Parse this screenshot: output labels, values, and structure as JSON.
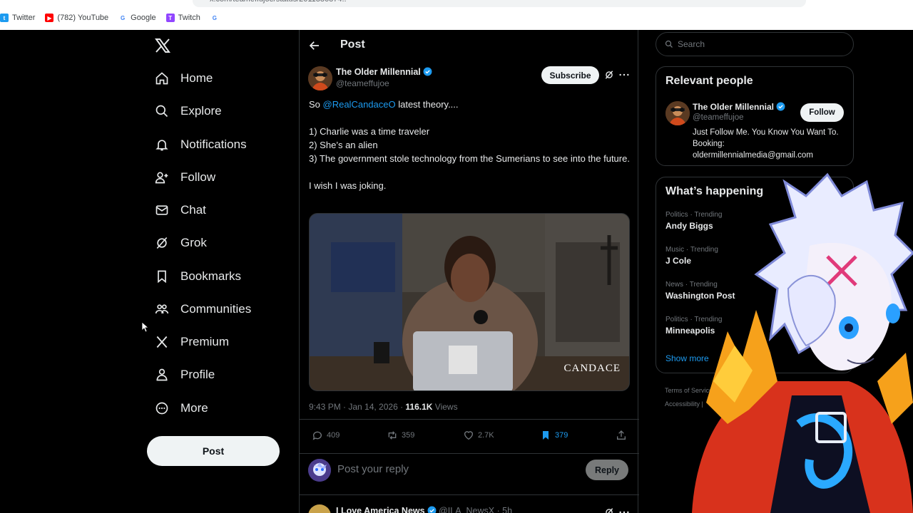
{
  "browser": {
    "url": "x.com/teameffujoe/status/2011886874..",
    "bookmarks": [
      {
        "label": "Twitter",
        "icon": "twitter-icon",
        "color": "#1d9bf0"
      },
      {
        "label": "(782) YouTube",
        "icon": "youtube-icon",
        "color": "#ff0000"
      },
      {
        "label": "Google",
        "icon": "google-icon",
        "color": "#4285f4"
      },
      {
        "label": "Twitch",
        "icon": "twitch-icon",
        "color": "#9146ff"
      },
      {
        "label": "",
        "icon": "google-icon",
        "color": "#4285f4"
      }
    ]
  },
  "nav": {
    "items": [
      {
        "label": "Home",
        "icon": "home-icon"
      },
      {
        "label": "Explore",
        "icon": "search-icon"
      },
      {
        "label": "Notifications",
        "icon": "bell-icon"
      },
      {
        "label": "Follow",
        "icon": "add-person-icon"
      },
      {
        "label": "Chat",
        "icon": "mail-icon"
      },
      {
        "label": "Grok",
        "icon": "grok-icon"
      },
      {
        "label": "Bookmarks",
        "icon": "bookmark-icon"
      },
      {
        "label": "Communities",
        "icon": "communities-icon"
      },
      {
        "label": "Premium",
        "icon": "x-logo-icon"
      },
      {
        "label": "Profile",
        "icon": "person-icon"
      },
      {
        "label": "More",
        "icon": "more-circle-icon"
      }
    ],
    "post_label": "Post"
  },
  "post": {
    "header_title": "Post",
    "author_name": "The Older Millennial",
    "author_handle": "@teameffujoe",
    "subscribe_label": "Subscribe",
    "text_prefix": "So ",
    "mention": "@RealCandaceO",
    "text_suffix": " latest theory....",
    "lines": [
      "1) Charlie was a time traveler",
      "2) She’s an alien",
      "3) The government stole technology from the Sumerians to see into the future."
    ],
    "closing": "I wish I was joking.",
    "media_watermark": "CANDACE",
    "time": "9:43 PM · Jan 14, 2026 · ",
    "views_count": "116.1K",
    "views_label": " Views",
    "replies": "409",
    "reposts": "359",
    "likes": "2.7K",
    "bookmarks": "379",
    "reply_placeholder": "Post your reply",
    "reply_button": "Reply",
    "next_author": "I Love America News",
    "next_handle": "@ILA_NewsX · 5h"
  },
  "sidebar": {
    "search_placeholder": "Search",
    "relevant_title": "Relevant people",
    "rp_name": "The Older Millennial",
    "rp_handle": "@teameffujoe",
    "follow_label": "Follow",
    "rp_bio": "Just Follow Me. You Know You Want To. Booking: oldermillennialmedia@gmail.com",
    "happening_title": "What’s happening",
    "trends": [
      {
        "category": "Politics · Trending",
        "name": "Andy Biggs"
      },
      {
        "category": "Music · Trending",
        "name": "J Cole"
      },
      {
        "category": "News · Trending",
        "name": "Washington Post"
      },
      {
        "category": "Politics · Trending",
        "name": "Minneapolis"
      }
    ],
    "show_more": "Show more",
    "footer_1": "Terms of Service",
    "footer_2": "Accessibility  |"
  },
  "colors": {
    "background": "#000000",
    "accent": "#1d9bf0",
    "text": "#e7e9ea",
    "muted": "#71767b",
    "border": "#2f3336"
  }
}
